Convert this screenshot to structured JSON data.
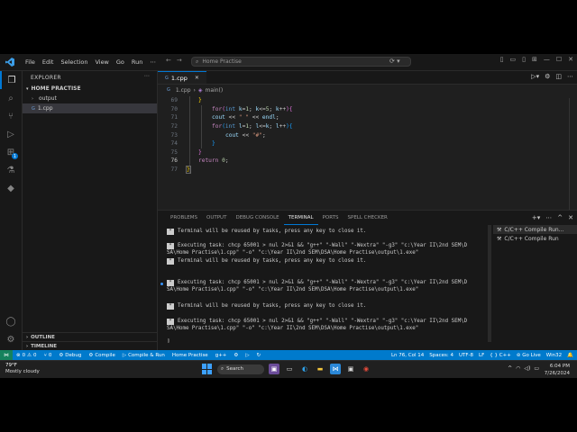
{
  "titlebar": {
    "menu": [
      "File",
      "Edit",
      "Selection",
      "View",
      "Go",
      "Run"
    ],
    "search_text": "Home Practise"
  },
  "sidebar": {
    "header": "EXPLORER",
    "root_folder": "HOME PRACTISE",
    "items": [
      {
        "label": "output",
        "kind": "folder"
      },
      {
        "label": "1.cpp",
        "kind": "file"
      }
    ],
    "outline": "OUTLINE",
    "timeline": "TIMELINE"
  },
  "editor": {
    "tab_label": "1.cpp",
    "breadcrumb": {
      "file": "1.cpp",
      "symbol": "main()"
    },
    "lines": [
      {
        "n": "69",
        "text": "}"
      },
      {
        "n": "70",
        "text": "for(int k=1; k<=5; k++){"
      },
      {
        "n": "71",
        "text": "cout << \" \" << endl;"
      },
      {
        "n": "72",
        "text": "for(int l=1; l<=k; l++){"
      },
      {
        "n": "73",
        "text": "cout << \"#\";"
      },
      {
        "n": "74",
        "text": "}"
      },
      {
        "n": "75",
        "text": "}"
      },
      {
        "n": "76",
        "text": "return 0;"
      },
      {
        "n": "77",
        "text": "}"
      }
    ]
  },
  "panel": {
    "tabs": [
      "PROBLEMS",
      "OUTPUT",
      "DEBUG CONSOLE",
      "TERMINAL",
      "PORTS",
      "SPELL CHECKER"
    ],
    "active_tab": "TERMINAL",
    "terminal_lines": [
      "Terminal will be reused by tasks, press any key to close it.",
      "Executing task: chcp 65001 > nul 2>&1 && \"g++\" \"-Wall\" \"-Wextra\" \"-g3\" \"c:\\Year II\\2nd SEM\\D",
      "SA\\Home Practise\\1.cpp\" \"-o\" \"c:\\Year II\\2nd SEM\\DSA\\Home Practise\\output\\1.exe\"",
      "Terminal will be reused by tasks, press any key to close it.",
      "Executing task: chcp 65001 > nul 2>&1 && \"g++\" \"-Wall\" \"-Wextra\" \"-g3\" \"c:\\Year II\\2nd SEM\\D",
      "SA\\Home Practise\\1.cpp\" \"-o\" \"c:\\Year II\\2nd SEM\\DSA\\Home Practise\\output\\1.exe\"",
      "Terminal will be reused by tasks, press any key to close it.",
      "Executing task: chcp 65001 > nul 2>&1 && \"g++\" \"-Wall\" \"-Wextra\" \"-g3\" \"c:\\Year II\\2nd SEM\\D",
      "SA\\Home Practise\\1.cpp\" \"-o\" \"c:\\Year II\\2nd SEM\\DSA\\Home Practise\\output\\1.exe\""
    ],
    "terminal_list": [
      "C/C++ Compile Run...",
      "C/C++ Compile Run"
    ]
  },
  "statusbar": {
    "errors": "0",
    "warnings": "0",
    "ports": "0",
    "debug": "Debug",
    "compile": "Compile",
    "compile_run": "Compile & Run",
    "folder": "Home Practise",
    "compiler": "g++",
    "position": "Ln 76, Col 14",
    "spaces": "Spaces: 4",
    "encoding": "UTF-8",
    "eol": "LF",
    "language": "C++",
    "go_live": "Go Live",
    "platform": "Win32"
  },
  "taskbar": {
    "temperature": "79°F",
    "weather": "Mostly cloudy",
    "search": "Search",
    "time": "6:04 PM",
    "date": "7/26/2024"
  },
  "colors": {
    "accent": "#007acc",
    "editor_bg": "#1f1f1f",
    "sidebar_bg": "#181818"
  }
}
